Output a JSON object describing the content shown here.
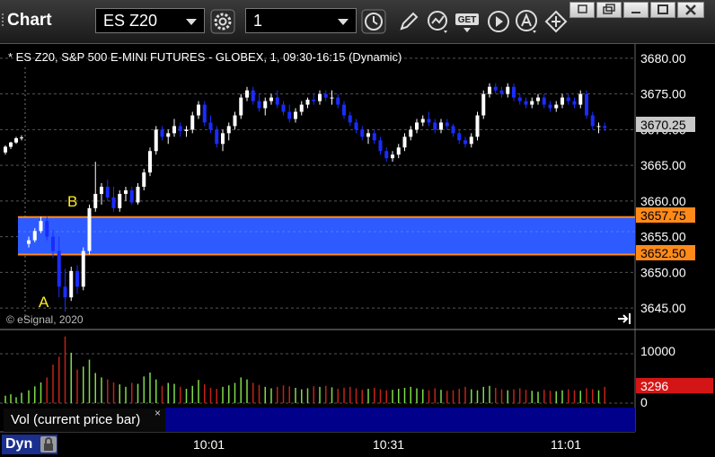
{
  "app": {
    "title": "Chart"
  },
  "toolbar": {
    "symbol": "ES Z20",
    "interval": "1",
    "get_label": "GET"
  },
  "chart": {
    "header": "* ES Z20, S&P 500 E-MINI FUTURES - GLOBEX, 1, 09:30-16:15 (Dynamic)",
    "copyright": "© eSignal, 2020",
    "price_ticks": [
      "3680.00",
      "3675.00",
      "3670.00",
      "3665.00",
      "3660.00",
      "3655.00",
      "3650.00",
      "3645.00"
    ],
    "last_price": "3670.25",
    "zone_top": "3657.75",
    "zone_bottom": "3652.50",
    "marker_a": "A",
    "marker_b": "B",
    "volume_ticks": [
      "10000",
      "0"
    ],
    "volume_last": "3296",
    "volume_label": "Vol (current price bar)",
    "volume_close": "×",
    "time_ticks": [
      "10:01",
      "10:31",
      "11:01"
    ],
    "status_mode": "Dyn"
  },
  "chart_data": {
    "type": "candlestick",
    "price_axis_range": [
      3642,
      3682
    ],
    "volume_axis_range": [
      0,
      14000
    ],
    "colors": {
      "up": "#ffffff",
      "down": "#1a2cff",
      "zone": "#2e5bff",
      "zone_line": "#ff8a1a",
      "vol_up": "#7ddc4a",
      "vol_down": "#c0221a"
    },
    "candles": [
      [
        3666.8,
        3667.8,
        3666.5,
        3667.6
      ],
      [
        3667.6,
        3668.3,
        3667.3,
        3668.2
      ],
      [
        3668.2,
        3669.0,
        3668.0,
        3668.8
      ],
      [
        3668.8,
        3669.2,
        3668.5,
        3668.9
      ],
      [
        3654.0,
        3655.0,
        3653.5,
        3654.5
      ],
      [
        3654.5,
        3656.2,
        3654.2,
        3655.8
      ],
      [
        3655.8,
        3657.8,
        3655.5,
        3657.2
      ],
      [
        3657.2,
        3657.8,
        3654.5,
        3655.0
      ],
      [
        3655.0,
        3656.0,
        3652.0,
        3653.0
      ],
      [
        3653.0,
        3655.0,
        3646.5,
        3648.0
      ],
      [
        3648.0,
        3650.5,
        3644.5,
        3646.5
      ],
      [
        3646.5,
        3650.8,
        3646.0,
        3650.2
      ],
      [
        3650.2,
        3651.0,
        3647.0,
        3648.0
      ],
      [
        3648.0,
        3653.5,
        3647.5,
        3653.0
      ],
      [
        3653.0,
        3659.5,
        3652.5,
        3659.0
      ],
      [
        3659.0,
        3665.5,
        3658.5,
        3661.0
      ],
      [
        3661.0,
        3662.5,
        3659.5,
        3662.0
      ],
      [
        3662.0,
        3663.0,
        3660.0,
        3660.5
      ],
      [
        3660.5,
        3662.0,
        3658.5,
        3659.0
      ],
      [
        3659.0,
        3661.5,
        3658.5,
        3661.0
      ],
      [
        3661.0,
        3662.0,
        3660.0,
        3661.5
      ],
      [
        3661.5,
        3662.0,
        3659.5,
        3659.8
      ],
      [
        3659.8,
        3662.5,
        3659.5,
        3662.0
      ],
      [
        3662.0,
        3664.5,
        3661.5,
        3664.0
      ],
      [
        3664.0,
        3667.5,
        3663.5,
        3667.0
      ],
      [
        3667.0,
        3670.5,
        3666.5,
        3670.0
      ],
      [
        3670.0,
        3670.5,
        3668.5,
        3669.0
      ],
      [
        3669.0,
        3670.0,
        3668.0,
        3669.5
      ],
      [
        3669.5,
        3671.5,
        3669.0,
        3670.5
      ],
      [
        3670.5,
        3671.0,
        3669.0,
        3669.8
      ],
      [
        3669.8,
        3670.5,
        3669.0,
        3670.0
      ],
      [
        3670.0,
        3672.5,
        3669.5,
        3672.0
      ],
      [
        3672.0,
        3674.0,
        3671.5,
        3673.5
      ],
      [
        3673.5,
        3674.0,
        3670.5,
        3671.0
      ],
      [
        3671.0,
        3672.0,
        3669.5,
        3670.0
      ],
      [
        3670.0,
        3670.5,
        3667.5,
        3668.0
      ],
      [
        3668.0,
        3670.0,
        3667.0,
        3669.5
      ],
      [
        3669.5,
        3671.0,
        3668.5,
        3670.5
      ],
      [
        3670.5,
        3672.5,
        3670.0,
        3672.0
      ],
      [
        3672.0,
        3675.0,
        3671.5,
        3674.5
      ],
      [
        3674.5,
        3676.0,
        3674.0,
        3675.5
      ],
      [
        3675.5,
        3676.0,
        3673.5,
        3674.0
      ],
      [
        3674.0,
        3675.0,
        3672.5,
        3673.0
      ],
      [
        3673.0,
        3674.5,
        3672.0,
        3674.0
      ],
      [
        3674.0,
        3675.0,
        3673.5,
        3674.5
      ],
      [
        3674.5,
        3675.5,
        3673.0,
        3673.5
      ],
      [
        3673.5,
        3674.0,
        3672.0,
        3672.5
      ],
      [
        3672.5,
        3673.5,
        3671.0,
        3671.5
      ],
      [
        3671.5,
        3673.0,
        3671.0,
        3672.5
      ],
      [
        3672.5,
        3674.0,
        3672.0,
        3673.5
      ],
      [
        3673.5,
        3674.5,
        3673.0,
        3674.2
      ],
      [
        3674.2,
        3675.0,
        3673.5,
        3674.0
      ],
      [
        3674.0,
        3675.5,
        3673.5,
        3675.0
      ],
      [
        3675.0,
        3675.5,
        3674.0,
        3674.5
      ],
      [
        3674.5,
        3675.5,
        3673.5,
        3674.5
      ],
      [
        3674.5,
        3675.0,
        3673.0,
        3673.5
      ],
      [
        3673.5,
        3674.0,
        3671.5,
        3672.0
      ],
      [
        3672.0,
        3672.5,
        3670.5,
        3671.0
      ],
      [
        3671.0,
        3671.5,
        3669.5,
        3670.0
      ],
      [
        3670.0,
        3670.5,
        3668.5,
        3669.0
      ],
      [
        3669.0,
        3670.0,
        3668.0,
        3669.5
      ],
      [
        3669.5,
        3670.0,
        3668.0,
        3668.5
      ],
      [
        3668.5,
        3669.0,
        3666.5,
        3667.0
      ],
      [
        3667.0,
        3667.5,
        3665.5,
        3666.0
      ],
      [
        3666.0,
        3667.0,
        3665.5,
        3666.5
      ],
      [
        3666.5,
        3668.0,
        3666.0,
        3667.5
      ],
      [
        3667.5,
        3669.5,
        3667.0,
        3669.0
      ],
      [
        3669.0,
        3670.5,
        3668.5,
        3670.0
      ],
      [
        3670.0,
        3671.5,
        3669.5,
        3671.0
      ],
      [
        3671.0,
        3672.0,
        3670.5,
        3671.5
      ],
      [
        3671.5,
        3672.5,
        3670.5,
        3671.0
      ],
      [
        3671.0,
        3671.5,
        3669.5,
        3670.0
      ],
      [
        3670.0,
        3671.5,
        3669.5,
        3671.0
      ],
      [
        3671.0,
        3671.5,
        3670.0,
        3670.5
      ],
      [
        3670.5,
        3670.8,
        3669.0,
        3669.5
      ],
      [
        3669.5,
        3670.0,
        3668.0,
        3668.5
      ],
      [
        3668.5,
        3669.0,
        3667.5,
        3668.0
      ],
      [
        3668.0,
        3669.5,
        3667.5,
        3669.0
      ],
      [
        3669.0,
        3672.5,
        3668.5,
        3672.0
      ],
      [
        3672.0,
        3675.5,
        3671.5,
        3675.0
      ],
      [
        3675.0,
        3676.5,
        3674.5,
        3676.0
      ],
      [
        3676.0,
        3676.5,
        3675.0,
        3675.5
      ],
      [
        3675.5,
        3676.0,
        3674.5,
        3675.0
      ],
      [
        3675.0,
        3676.5,
        3674.5,
        3676.0
      ],
      [
        3676.0,
        3676.5,
        3674.0,
        3674.5
      ],
      [
        3674.5,
        3675.0,
        3673.5,
        3674.0
      ],
      [
        3674.0,
        3674.5,
        3673.0,
        3673.5
      ],
      [
        3673.5,
        3674.5,
        3673.0,
        3674.0
      ],
      [
        3674.0,
        3675.0,
        3673.5,
        3674.5
      ],
      [
        3674.5,
        3675.0,
        3673.0,
        3673.5
      ],
      [
        3673.5,
        3674.0,
        3672.5,
        3673.0
      ],
      [
        3673.0,
        3674.0,
        3672.5,
        3673.5
      ],
      [
        3673.5,
        3675.0,
        3673.0,
        3674.5
      ],
      [
        3674.5,
        3675.0,
        3673.5,
        3674.0
      ],
      [
        3674.0,
        3674.5,
        3673.0,
        3673.5
      ],
      [
        3673.5,
        3675.5,
        3673.0,
        3675.0
      ],
      [
        3675.0,
        3675.5,
        3671.5,
        3672.0
      ],
      [
        3672.0,
        3672.5,
        3670.0,
        3670.5
      ],
      [
        3670.5,
        3671.0,
        3669.5,
        3670.5
      ],
      [
        3670.5,
        3671.0,
        3669.8,
        3670.25
      ]
    ],
    "volumes": [
      1500,
      1800,
      1200,
      2100,
      2600,
      3400,
      4200,
      5200,
      7800,
      9400,
      13500,
      10200,
      6800,
      7400,
      8800,
      6100,
      5200,
      4800,
      4200,
      3800,
      3300,
      4100,
      3900,
      5400,
      6200,
      4800,
      3500,
      4100,
      3900,
      3300,
      2900,
      3500,
      4700,
      3800,
      3100,
      2900,
      3300,
      3600,
      4100,
      5200,
      4800,
      4100,
      3700,
      3300,
      3000,
      3300,
      3600,
      3400,
      3100,
      2800,
      3000,
      3400,
      3300,
      3500,
      3200,
      2900,
      3100,
      3300,
      3000,
      2700,
      2900,
      3100,
      2800,
      2600,
      2700,
      2900,
      3100,
      3300,
      3000,
      2800,
      2600,
      3000,
      2700,
      2500,
      2600,
      2900,
      3300,
      2800,
      2600,
      3300,
      3500,
      3100,
      2800,
      2600,
      2800,
      3000,
      2700,
      2500,
      2300,
      2700,
      2500,
      2400,
      2600,
      2800,
      2600,
      2500,
      3000,
      2800,
      2600,
      3296
    ]
  }
}
